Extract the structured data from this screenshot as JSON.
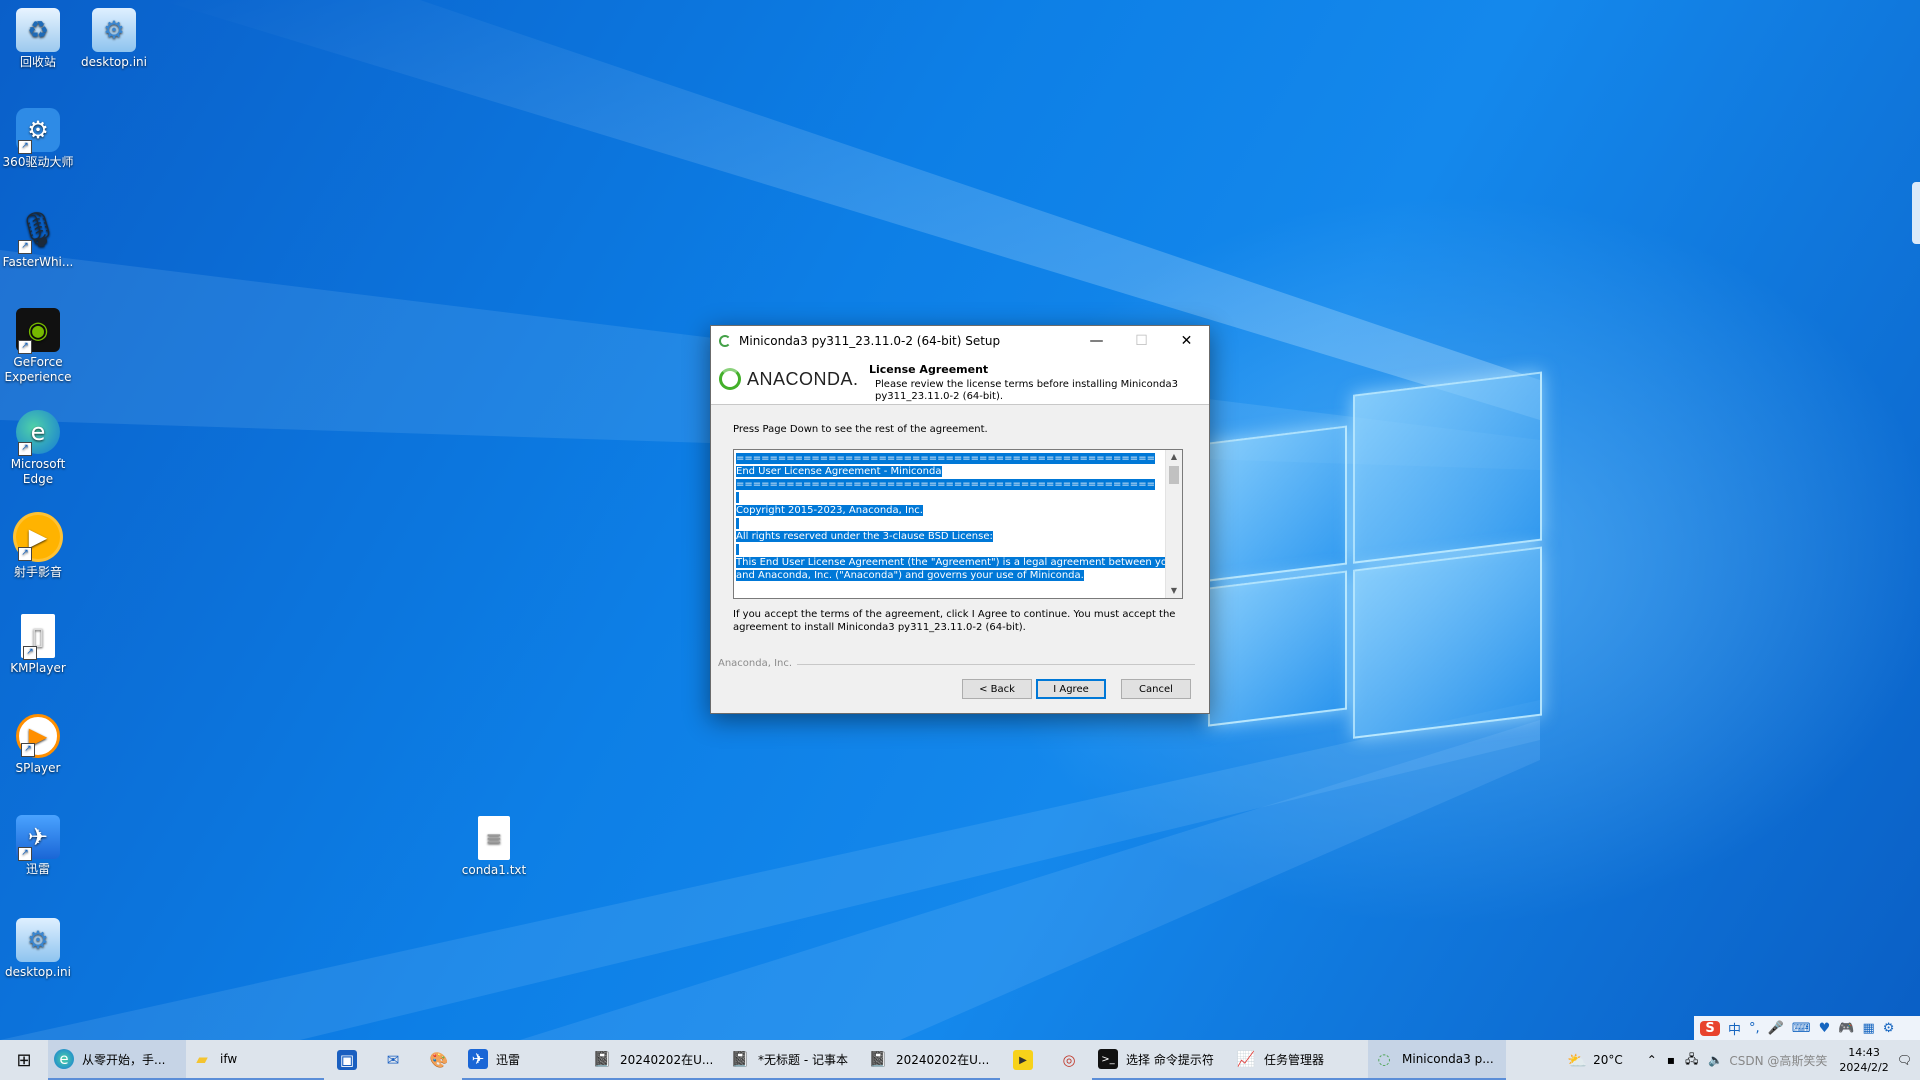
{
  "desktop": {
    "icons": [
      {
        "label": "回收站",
        "icon": "recycle-bin-icon"
      },
      {
        "label": "desktop.ini",
        "icon": "settings-file-icon"
      },
      {
        "label": "360驱动大师",
        "icon": "gear-icon"
      },
      {
        "label": "FasterWhi...",
        "icon": "microphone-icon"
      },
      {
        "label": "GeForce Experience",
        "icon": "nvidia-icon"
      },
      {
        "label": "Microsoft Edge",
        "icon": "edge-icon"
      },
      {
        "label": "射手影音",
        "icon": "media-player-icon"
      },
      {
        "label": "KMPlayer",
        "icon": "file-icon"
      },
      {
        "label": "SPlayer",
        "icon": "play-icon"
      },
      {
        "label": "迅雷",
        "icon": "bird-icon"
      },
      {
        "label": "desktop.ini",
        "icon": "settings-file-icon"
      },
      {
        "label": "conda1.txt",
        "icon": "text-file-icon"
      }
    ]
  },
  "dialog": {
    "title": "Miniconda3 py311_23.11.0-2 (64-bit) Setup",
    "logo_text": "ANACONDA.",
    "header_title": "License Agreement",
    "header_subtitle": "Please review the license terms before installing Miniconda3 py311_23.11.0-2 (64-bit).",
    "intro": "Press Page Down to see the rest of the agreement.",
    "license_lines": [
      "==================================================",
      "End User License Agreement - Miniconda",
      "==================================================",
      "",
      "Copyright 2015-2023, Anaconda, Inc.",
      "",
      "All rights reserved under the 3-clause BSD License:",
      "",
      "This End User License Agreement (the \"Agreement\") is a legal agreement between you",
      "and Anaconda, Inc. (\"Anaconda\") and governs your use of Miniconda."
    ],
    "accept_text": "If you accept the terms of the agreement, click I Agree to continue. You must accept the agreement to install Miniconda3 py311_23.11.0-2 (64-bit).",
    "brand": "Anaconda, Inc.",
    "buttons": {
      "back": "< Back",
      "agree": "I Agree",
      "cancel": "Cancel"
    }
  },
  "taskbar": {
    "items": [
      {
        "label": "从零开始，手...",
        "icon": "edge-icon"
      },
      {
        "label": "ifw",
        "icon": "folder-icon"
      },
      {
        "label": "",
        "icon": "store-icon"
      },
      {
        "label": "",
        "icon": "mail-icon"
      },
      {
        "label": "",
        "icon": "paint-icon"
      },
      {
        "label": "迅雷",
        "icon": "bird-icon"
      },
      {
        "label": "20240202在U...",
        "icon": "notepad-icon"
      },
      {
        "label": "*无标题 - 记事本",
        "icon": "notepad-icon"
      },
      {
        "label": "20240202在U...",
        "icon": "notepad-icon"
      },
      {
        "label": "",
        "icon": "player-icon"
      },
      {
        "label": "",
        "icon": "capture-icon"
      },
      {
        "label": "选择 命令提示符",
        "icon": "cmd-icon"
      },
      {
        "label": "任务管理器",
        "icon": "task-manager-icon"
      },
      {
        "label": "Miniconda3 p...",
        "icon": "miniconda-icon"
      }
    ],
    "weather": "20°C",
    "time": "14:43",
    "date": "2024/2/2",
    "watermark": "CSDN @高斯笑笑",
    "ime_mode": "中"
  }
}
